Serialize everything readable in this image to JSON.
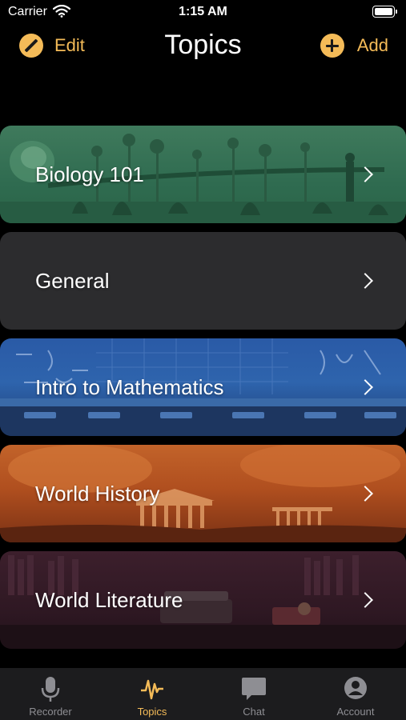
{
  "status": {
    "carrier": "Carrier",
    "time": "1:15 AM"
  },
  "nav": {
    "edit_label": "Edit",
    "title": "Topics",
    "add_label": "Add",
    "accent_color": "#f4bb58"
  },
  "topics": [
    {
      "label": "Biology 101"
    },
    {
      "label": "General"
    },
    {
      "label": "Intro to Mathematics"
    },
    {
      "label": "World History"
    },
    {
      "label": "World Literature"
    }
  ],
  "tabs": [
    {
      "label": "Recorder",
      "icon": "microphone-icon",
      "active": false
    },
    {
      "label": "Topics",
      "icon": "waveform-icon",
      "active": true
    },
    {
      "label": "Chat",
      "icon": "chat-bubble-icon",
      "active": false
    },
    {
      "label": "Account",
      "icon": "account-icon",
      "active": false
    }
  ]
}
